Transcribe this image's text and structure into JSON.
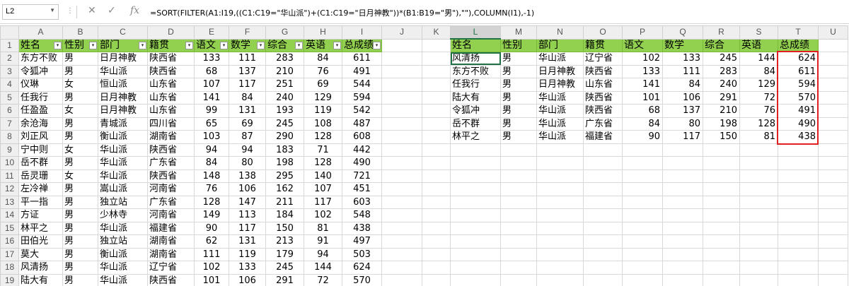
{
  "formula_bar": {
    "name_box": "L2",
    "formula": "=SORT(FILTER(A1:I19,((C1:C19=\"华山派\")+(C1:C19=\"日月神教\"))*(B1:B19=\"男\"),\"\"),COLUMN(I1),-1)",
    "icons": [
      "close-icon",
      "check-icon",
      "function-icon"
    ]
  },
  "columns": [
    "A",
    "B",
    "C",
    "D",
    "E",
    "F",
    "G",
    "H",
    "I",
    "J",
    "K",
    "L",
    "M",
    "N",
    "O",
    "P",
    "Q",
    "R",
    "S",
    "T",
    "U"
  ],
  "left_table": {
    "headers": [
      "姓名",
      "性别",
      "部门",
      "籍贯",
      "语文",
      "数学",
      "综合",
      "英语",
      "总成绩"
    ],
    "rows": [
      [
        "东方不败",
        "男",
        "日月神教",
        "陕西省",
        "133",
        "111",
        "283",
        "84",
        "611"
      ],
      [
        "令狐冲",
        "男",
        "华山派",
        "陕西省",
        "68",
        "137",
        "210",
        "76",
        "491"
      ],
      [
        "仪琳",
        "女",
        "恒山派",
        "山东省",
        "107",
        "117",
        "251",
        "69",
        "544"
      ],
      [
        "任我行",
        "男",
        "日月神教",
        "山东省",
        "141",
        "84",
        "240",
        "129",
        "594"
      ],
      [
        "任盈盈",
        "女",
        "日月神教",
        "山东省",
        "99",
        "131",
        "193",
        "119",
        "542"
      ],
      [
        "余沧海",
        "男",
        "青城派",
        "四川省",
        "65",
        "69",
        "245",
        "108",
        "487"
      ],
      [
        "刘正风",
        "男",
        "衡山派",
        "湖南省",
        "103",
        "87",
        "290",
        "128",
        "608"
      ],
      [
        "宁中则",
        "女",
        "华山派",
        "陕西省",
        "94",
        "94",
        "183",
        "71",
        "442"
      ],
      [
        "岳不群",
        "男",
        "华山派",
        "广东省",
        "84",
        "80",
        "198",
        "128",
        "490"
      ],
      [
        "岳灵珊",
        "女",
        "华山派",
        "陕西省",
        "148",
        "138",
        "295",
        "140",
        "721"
      ],
      [
        "左冷禅",
        "男",
        "嵩山派",
        "河南省",
        "76",
        "106",
        "162",
        "107",
        "451"
      ],
      [
        "平一指",
        "男",
        "独立站",
        "广东省",
        "128",
        "147",
        "211",
        "117",
        "603"
      ],
      [
        "方证",
        "男",
        "少林寺",
        "河南省",
        "149",
        "113",
        "184",
        "102",
        "548"
      ],
      [
        "林平之",
        "男",
        "华山派",
        "福建省",
        "90",
        "117",
        "150",
        "81",
        "438"
      ],
      [
        "田伯光",
        "男",
        "独立站",
        "湖南省",
        "62",
        "131",
        "213",
        "91",
        "497"
      ],
      [
        "莫大",
        "男",
        "衡山派",
        "湖南省",
        "111",
        "119",
        "179",
        "94",
        "503"
      ],
      [
        "风清扬",
        "男",
        "华山派",
        "辽宁省",
        "102",
        "133",
        "245",
        "144",
        "624"
      ],
      [
        "陆大有",
        "男",
        "华山派",
        "陕西省",
        "101",
        "106",
        "291",
        "72",
        "570"
      ]
    ]
  },
  "right_table": {
    "headers": [
      "姓名",
      "性别",
      "部门",
      "籍贯",
      "语文",
      "数学",
      "综合",
      "英语",
      "总成绩"
    ],
    "rows": [
      [
        "风清扬",
        "男",
        "华山派",
        "辽宁省",
        "102",
        "133",
        "245",
        "144",
        "624"
      ],
      [
        "东方不败",
        "男",
        "日月神教",
        "陕西省",
        "133",
        "111",
        "283",
        "84",
        "611"
      ],
      [
        "任我行",
        "男",
        "日月神教",
        "山东省",
        "141",
        "84",
        "240",
        "129",
        "594"
      ],
      [
        "陆大有",
        "男",
        "华山派",
        "陕西省",
        "101",
        "106",
        "291",
        "72",
        "570"
      ],
      [
        "令狐冲",
        "男",
        "华山派",
        "陕西省",
        "68",
        "137",
        "210",
        "76",
        "491"
      ],
      [
        "岳不群",
        "男",
        "华山派",
        "广东省",
        "84",
        "80",
        "198",
        "128",
        "490"
      ],
      [
        "林平之",
        "男",
        "华山派",
        "福建省",
        "90",
        "117",
        "150",
        "81",
        "438"
      ]
    ]
  },
  "colors": {
    "header_fill": "#92d050",
    "highlight_box": "#e02020",
    "selection": "#217346"
  }
}
